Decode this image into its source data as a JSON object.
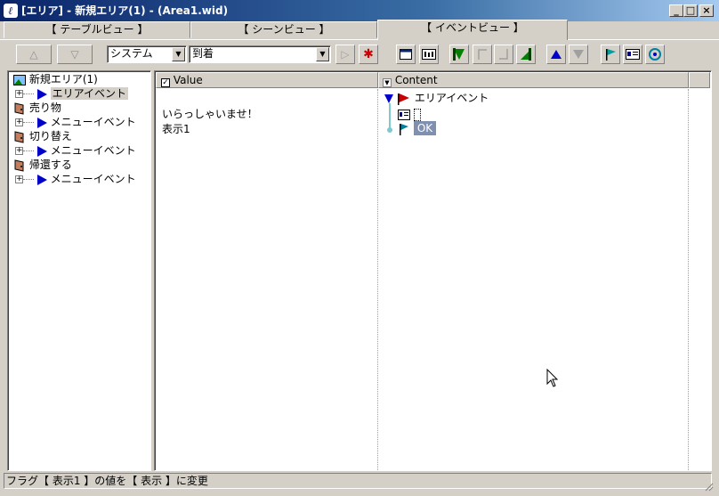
{
  "window": {
    "title": "[エリア] - 新規エリア(1) - (Area1.wid)",
    "min_label": "_",
    "max_label": "□",
    "close_label": "×"
  },
  "tabs": [
    {
      "label": "【 テーブルビュー 】",
      "active": false
    },
    {
      "label": "【 シーンビュー 】",
      "active": false
    },
    {
      "label": "【 イベントビュー 】",
      "active": true
    }
  ],
  "toolbar": {
    "up_label": "△",
    "down_label": "▽",
    "category_select": "システム",
    "event_select": "到着",
    "play_label": "▷",
    "stop_label": "✱"
  },
  "tree": {
    "area_name": "新規エリア(1)",
    "items": [
      {
        "type": "event",
        "label": "エリアイベント",
        "selected": true
      },
      {
        "type": "object",
        "label": "売り物"
      },
      {
        "type": "event",
        "label": "メニューイベント"
      },
      {
        "type": "object",
        "label": "切り替え"
      },
      {
        "type": "event",
        "label": "メニューイベント"
      },
      {
        "type": "object",
        "label": "帰還する"
      },
      {
        "type": "event",
        "label": "メニューイベント"
      }
    ]
  },
  "value_pane": {
    "header": "Value",
    "lines": [
      "いらっしゃいませ！",
      "表示1"
    ]
  },
  "content_pane": {
    "header": "Content",
    "root_label": "エリアイベント",
    "flag_label": "OK"
  },
  "status": {
    "text": "フラグ【 表示1 】の値を【 表示 】に変更"
  },
  "colors": {
    "accent_blue": "#0000cc",
    "flag_red": "#cc0000",
    "flag_green": "#008000",
    "selection": "#8090b0"
  }
}
